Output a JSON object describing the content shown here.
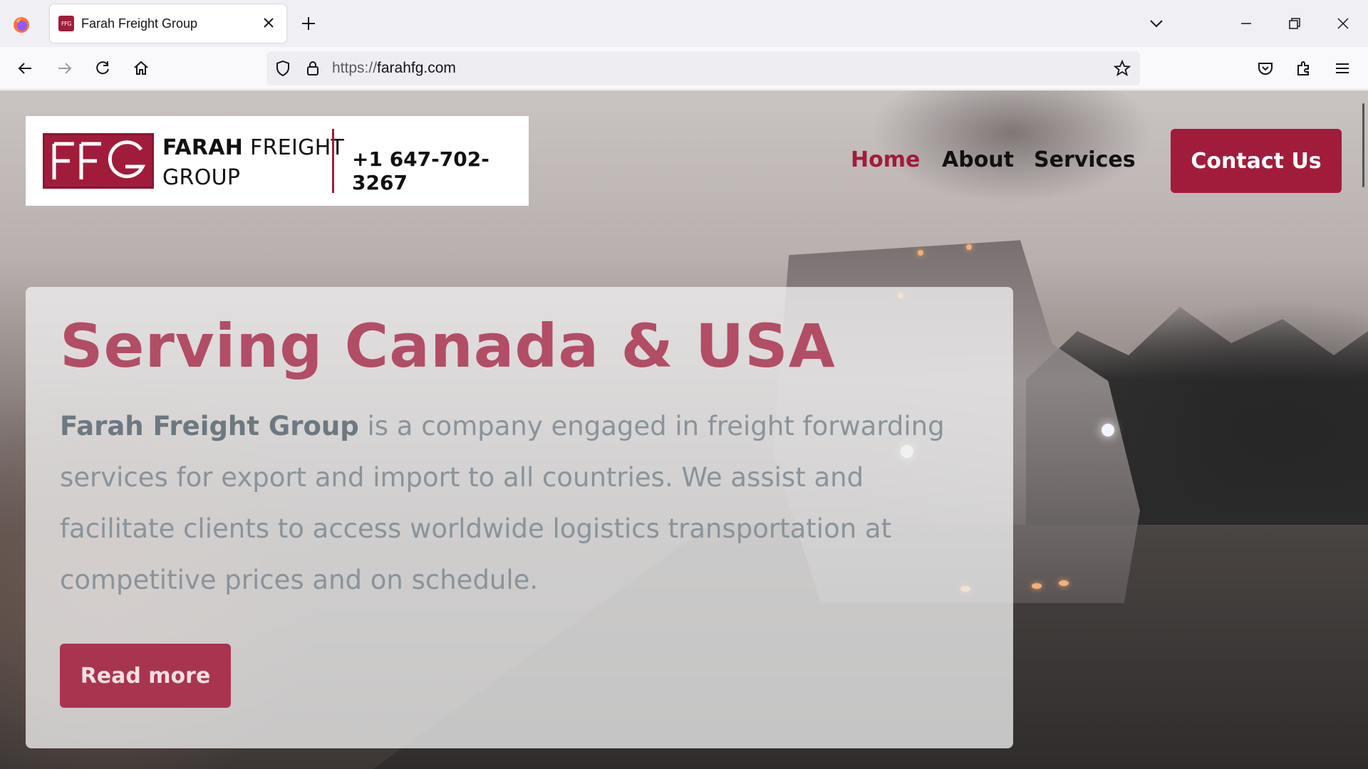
{
  "browser": {
    "tab_title": "Farah Freight Group",
    "tab_favicon_text": "FFG",
    "url_protocol": "https://",
    "url_domain": "farahfg.com"
  },
  "header": {
    "logo_text": "FFG",
    "brand_bold": "FARAH",
    "brand_rest": " FREIGHT",
    "brand_line2": "GROUP",
    "phone": "+1 647-702-3267"
  },
  "nav": {
    "home": "Home",
    "about": "About",
    "services": "Services",
    "contact": "Contact Us"
  },
  "hero": {
    "title": "Serving Canada & USA",
    "company": "Farah Freight Group",
    "body": " is a company engaged in freight forwarding services for export and import to all countries. We assist and facilitate clients to access worldwide logistics transportation at competitive prices and on schedule.",
    "button": "Read more"
  },
  "colors": {
    "brand": "#a11c3b",
    "hero_title": "#b24d66",
    "hero_text": "#8a939b"
  }
}
